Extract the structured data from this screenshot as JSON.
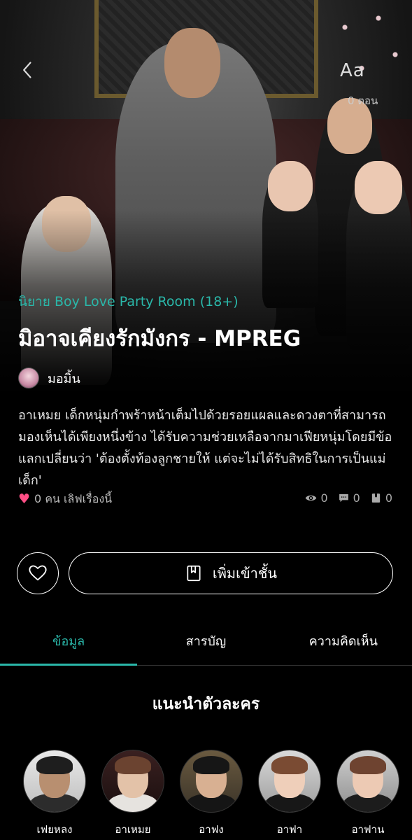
{
  "header": {
    "aa_label": "Aa",
    "episodes_text": "0 ตอน"
  },
  "novel": {
    "category": "นิยาย Boy Love Party Room (18+)",
    "title": "มิอาจเคียงรักมังกร - MPREG",
    "author": "มอมิ้น",
    "synopsis": "อาเหมย เด็กหนุ่มกำพร้าหน้าเต็มไปด้วยรอยแผลและดวงตาที่สามารถมองเห็นได้เพียงหนึ่งข้าง ได้รับความช่วยเหลือจากมาเฟียหนุ่มโดยมีข้อแลกเปลี่ยนว่า 'ต้องตั้งท้องลูกชายให้ แต่จะไม่ได้รับสิทธิในการเป็นแม่เด็ก'",
    "likes_text": "0 คน เลิฟเรื่องนี้",
    "stats": {
      "views": "0",
      "comments": "0",
      "library": "0"
    }
  },
  "actions": {
    "add_to_shelf_label": "เพิ่มเข้าชั้น"
  },
  "tabs": [
    {
      "label": "ข้อมูล",
      "active": true
    },
    {
      "label": "สารบัญ",
      "active": false
    },
    {
      "label": "ความคิดเห็น",
      "active": false
    }
  ],
  "characters_section": {
    "title": "แนะนำตัวละคร",
    "characters": [
      {
        "name": "เฟยหลง"
      },
      {
        "name": "อาเหมย"
      },
      {
        "name": "อาฟง"
      },
      {
        "name": "อาฟา"
      },
      {
        "name": "อาฟาน"
      }
    ]
  },
  "colors": {
    "accent": "#2ab7a9",
    "heart": "#ff4f86",
    "background": "#000000"
  }
}
